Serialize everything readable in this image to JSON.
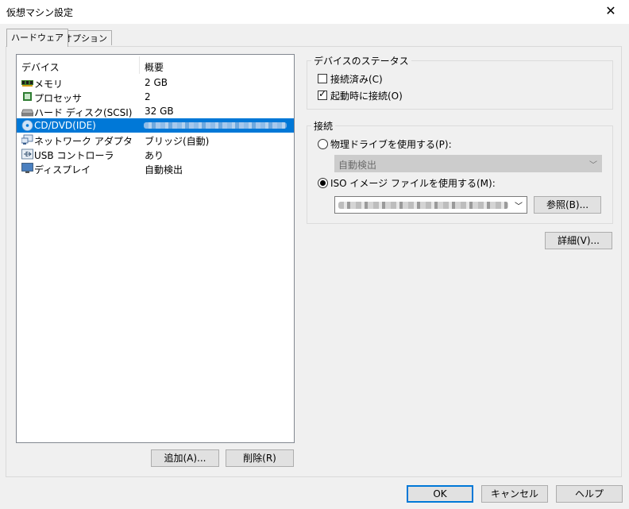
{
  "window": {
    "title": "仮想マシン設定"
  },
  "tabs": [
    {
      "label": "ハードウェア",
      "active": true
    },
    {
      "label": "オプション",
      "active": false
    }
  ],
  "device_list": {
    "columns": [
      "デバイス",
      "概要"
    ],
    "rows": [
      {
        "name": "メモリ",
        "summary": "2 GB",
        "icon": "memory-icon"
      },
      {
        "name": "プロセッサ",
        "summary": "2",
        "icon": "processor-icon"
      },
      {
        "name": "ハード ディスク(SCSI)",
        "summary": "32 GB",
        "icon": "hard-disk-icon"
      },
      {
        "name": "CD/DVD(IDE)",
        "summary": "",
        "icon": "cd-dvd-icon",
        "selected": true
      },
      {
        "name": "ネットワーク アダプタ",
        "summary": "ブリッジ(自動)",
        "icon": "network-adapter-icon"
      },
      {
        "name": "USB コントローラ",
        "summary": "あり",
        "icon": "usb-controller-icon"
      },
      {
        "name": "ディスプレイ",
        "summary": "自動検出",
        "icon": "display-icon"
      }
    ]
  },
  "list_buttons": {
    "add": "追加(A)...",
    "remove": "削除(R)"
  },
  "device_status": {
    "legend": "デバイスのステータス",
    "connected": {
      "label": "接続済み(C)",
      "checked": false
    },
    "connect_at_power_on": {
      "label": "起動時に接続(O)",
      "checked": true
    }
  },
  "connection": {
    "legend": "接続",
    "physical_drive": {
      "label": "物理ドライブを使用する(P):",
      "selected": false,
      "value": "自動検出"
    },
    "iso_image": {
      "label": "ISO イメージ ファイルを使用する(M):",
      "selected": true
    },
    "browse_label": "参照(B)..."
  },
  "advanced_label": "詳細(V)...",
  "footer": {
    "ok": "OK",
    "cancel": "キャンセル",
    "help": "ヘルプ"
  },
  "colors": {
    "selection": "#0078d7",
    "dialog_bg": "#f0f0f0"
  }
}
